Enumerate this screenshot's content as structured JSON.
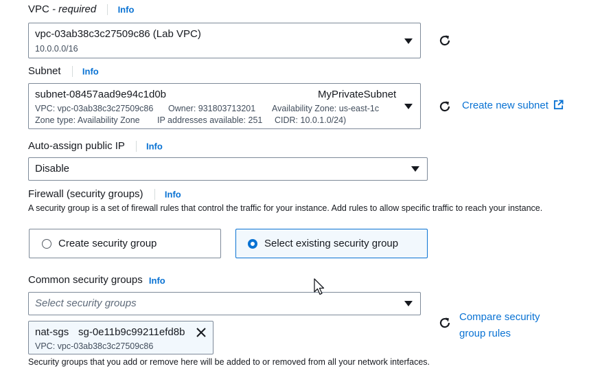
{
  "vpc": {
    "label": "VPC",
    "required": "- required",
    "info": "Info",
    "selected_name": "vpc-03ab38c3c27509c86 (Lab VPC)",
    "selected_cidr": "10.0.0.0/16"
  },
  "subnet": {
    "label": "Subnet",
    "info": "Info",
    "selected_id": "subnet-08457aad9e94c1d0b",
    "selected_name": "MyPrivateSubnet",
    "detail_vpc": "VPC: vpc-03ab38c3c27509c86",
    "detail_owner": "Owner: 931803713201",
    "detail_az": "Availability Zone: us-east-1c",
    "detail_zone_type": "Zone type: Availability Zone",
    "detail_ips": "IP addresses available: 251",
    "detail_cidr": "CIDR: 10.0.1.0/24)",
    "create_link": "Create new subnet"
  },
  "public_ip": {
    "label": "Auto-assign public IP",
    "info": "Info",
    "value": "Disable"
  },
  "firewall": {
    "label": "Firewall (security groups)",
    "info": "Info",
    "description": "A security group is a set of firewall rules that control the traffic for your instance. Add rules to allow specific traffic to reach your instance.",
    "option_create": "Create security group",
    "option_existing": "Select existing security group",
    "selected": "existing"
  },
  "common_sg": {
    "label": "Common security groups",
    "info": "Info",
    "placeholder": "Select security groups",
    "token_name": "nat-sgs",
    "token_id": "sg-0e11b9c99211efd8b",
    "token_vpc": "VPC: vpc-03ab38c3c27509c86",
    "compare_line1": "Compare security",
    "compare_line2": "group rules",
    "footer": "Security groups that you add or remove here will be added to or removed from all your network interfaces."
  },
  "colors": {
    "link": "#0972d3",
    "border": "#7d8998",
    "text": "#16191f",
    "selected_bg": "#f2f8fd"
  }
}
